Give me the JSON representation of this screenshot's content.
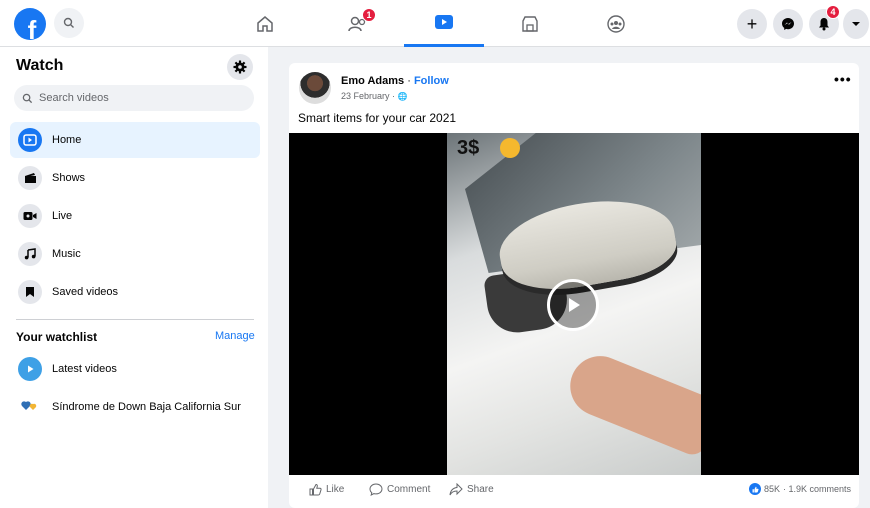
{
  "colors": {
    "brand": "#1877f2",
    "badge": "#e41e3f",
    "bg": "#f0f2f5"
  },
  "topbar": {
    "logo_letter": "f",
    "nav": [
      {
        "name": "home",
        "icon": "home-icon"
      },
      {
        "name": "friends",
        "icon": "friends-icon",
        "badge": "1"
      },
      {
        "name": "watch",
        "icon": "watch-icon",
        "active": true
      },
      {
        "name": "marketplace",
        "icon": "marketplace-icon"
      },
      {
        "name": "groups",
        "icon": "groups-icon"
      }
    ],
    "create_icon": "+",
    "notifications_badge": "4"
  },
  "sidebar": {
    "title": "Watch",
    "search_placeholder": "Search videos",
    "items": [
      {
        "label": "Home",
        "icon": "watch-home-icon",
        "active": true
      },
      {
        "label": "Shows",
        "icon": "shows-icon"
      },
      {
        "label": "Live",
        "icon": "live-icon"
      },
      {
        "label": "Music",
        "icon": "music-icon"
      },
      {
        "label": "Saved videos",
        "icon": "saved-icon"
      }
    ],
    "watchlist_title": "Your watchlist",
    "manage_label": "Manage",
    "watchlist": [
      {
        "label": "Latest videos",
        "icon": "play-icon"
      },
      {
        "label": "Síndrome de Down Baja California Sur",
        "icon": "page-avatar-icon"
      }
    ]
  },
  "post": {
    "author": "Emo Adams",
    "separator": " · ",
    "follow": "Follow",
    "date": "23 February · ",
    "globe": "🌐",
    "more": "•••",
    "caption": "Smart items for your car 2021",
    "video_overlay_text": "3$",
    "actions": {
      "like": "Like",
      "comment": "Comment",
      "share": "Share"
    },
    "reactions": "85K",
    "comments": " · 1.9K comments"
  }
}
